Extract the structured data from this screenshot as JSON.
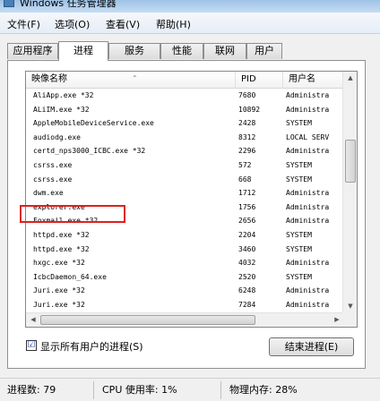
{
  "window": {
    "title": "Windows 任务管理器"
  },
  "menu": [
    {
      "label": "文件(F)"
    },
    {
      "label": "选项(O)"
    },
    {
      "label": "查看(V)"
    },
    {
      "label": "帮助(H)"
    }
  ],
  "tabs": [
    {
      "label": "应用程序",
      "active": false
    },
    {
      "label": "进程",
      "active": true
    },
    {
      "label": "服务",
      "active": false
    },
    {
      "label": "性能",
      "active": false
    },
    {
      "label": "联网",
      "active": false
    },
    {
      "label": "用户",
      "active": false
    }
  ],
  "process_list": {
    "columns": [
      {
        "label": "映像名称"
      },
      {
        "label": "PID"
      },
      {
        "label": "用户名"
      }
    ],
    "rows": [
      {
        "name": "AliApp.exe *32",
        "pid": "7680",
        "user": "Administra"
      },
      {
        "name": "ALiIM.exe *32",
        "pid": "10892",
        "user": "Administra"
      },
      {
        "name": "AppleMobileDeviceService.exe",
        "pid": "2428",
        "user": "SYSTEM"
      },
      {
        "name": "audiodg.exe",
        "pid": "8312",
        "user": "LOCAL SERV"
      },
      {
        "name": "certd_nps3000_ICBC.exe *32",
        "pid": "2296",
        "user": "Administra"
      },
      {
        "name": "csrss.exe",
        "pid": "572",
        "user": "SYSTEM"
      },
      {
        "name": "csrss.exe",
        "pid": "668",
        "user": "SYSTEM"
      },
      {
        "name": "dwm.exe",
        "pid": "1712",
        "user": "Administra"
      },
      {
        "name": "explorer.exe",
        "pid": "1756",
        "user": "Administra"
      },
      {
        "name": "Foxmail.exe *32",
        "pid": "2656",
        "user": "Administra"
      },
      {
        "name": "httpd.exe *32",
        "pid": "2204",
        "user": "SYSTEM"
      },
      {
        "name": "httpd.exe *32",
        "pid": "3460",
        "user": "SYSTEM"
      },
      {
        "name": "hxgc.exe *32",
        "pid": "4032",
        "user": "Administra"
      },
      {
        "name": "IcbcDaemon_64.exe",
        "pid": "2520",
        "user": "SYSTEM"
      },
      {
        "name": "Juri.exe *32",
        "pid": "6248",
        "user": "Administra"
      },
      {
        "name": "Juri.exe *32",
        "pid": "7284",
        "user": "Administra"
      }
    ]
  },
  "show_all": {
    "label": "显示所有用户的进程(S)",
    "checked": "☑"
  },
  "end_process_button": {
    "label": "结束进程(E)"
  },
  "status": {
    "processes": "进程数: 79",
    "cpu": "CPU 使用率: 1%",
    "memory": "物理内存: 28%"
  },
  "colors": {
    "highlight": "#e0201e",
    "accent": "#4a7fb8"
  }
}
